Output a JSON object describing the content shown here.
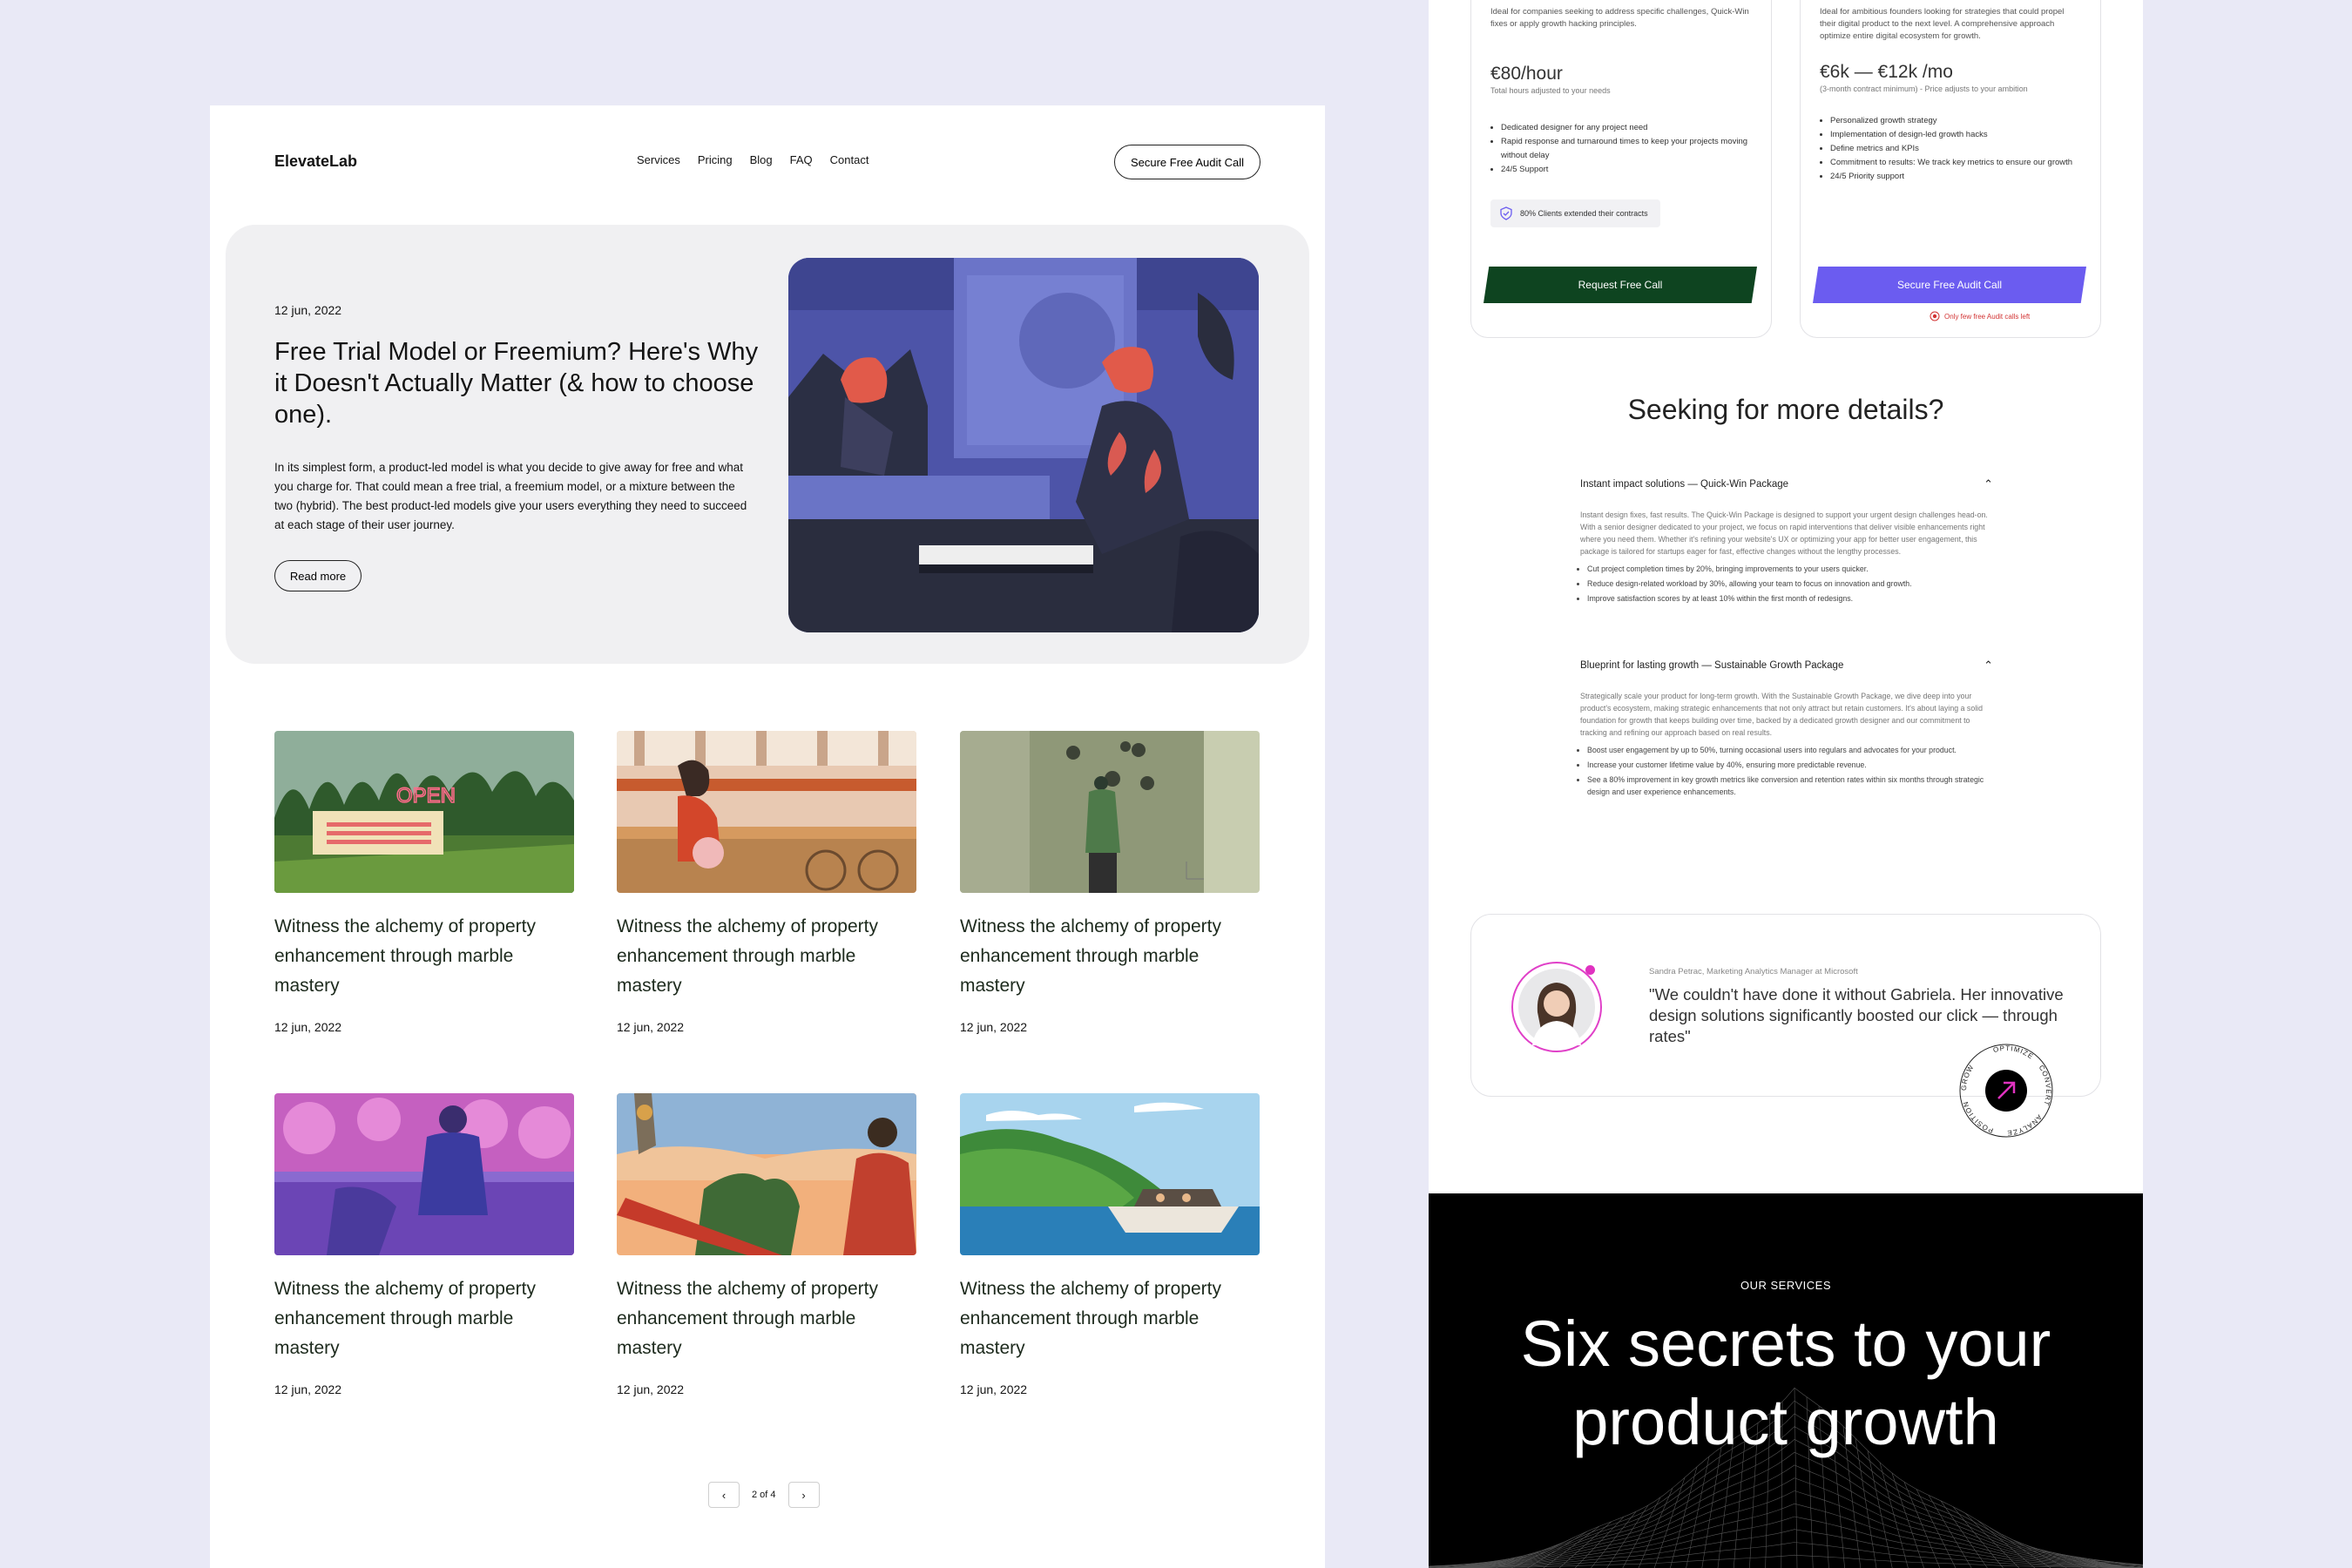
{
  "blog": {
    "logo": "ElevateLab",
    "nav": [
      "Services",
      "Pricing",
      "Blog",
      "FAQ",
      "Contact"
    ],
    "cta": "Secure Free Audit Call",
    "hero": {
      "date": "12 jun, 2022",
      "title": "Free Trial Model or Freemium? Here's Why it Doesn't Actually Matter (& how to choose one).",
      "body": "In its simplest form, a product-led model is what you decide to give away for free and what you charge for. That could mean a free trial, a freemium model, or a mixture between the two (hybrid). The best product-led models give your users everything they need to succeed at each stage of their user journey.",
      "read_more": "Read more"
    },
    "posts": [
      {
        "title": "Witness the alchemy of property enhancement through marble mastery",
        "date": "12 jun, 2022"
      },
      {
        "title": "Witness the alchemy of property enhancement through marble mastery",
        "date": "12 jun, 2022"
      },
      {
        "title": "Witness the alchemy of property enhancement through marble mastery",
        "date": "12 jun, 2022"
      },
      {
        "title": "Witness the alchemy of property enhancement through marble mastery",
        "date": "12 jun, 2022"
      },
      {
        "title": "Witness the alchemy of property enhancement through marble mastery",
        "date": "12 jun, 2022"
      },
      {
        "title": "Witness the alchemy of property enhancement through marble mastery",
        "date": "12 jun, 2022"
      }
    ],
    "pagination": {
      "prev": "‹",
      "label": "2 of 4",
      "next": "›"
    },
    "neon_sign": "OPEN"
  },
  "pricing": {
    "plans": [
      {
        "desc": "Ideal for companies seeking to address specific challenges, Quick-Win fixes or apply growth hacking principles.",
        "price": "€80/hour",
        "note": "Total hours adjusted to your needs",
        "features": [
          "Dedicated designer for any project need",
          "Rapid response and turnaround times to keep your projects moving without delay",
          "24/5 Support"
        ],
        "badge": "80% Clients extended their contracts",
        "button": "Request Free Call",
        "button_color": "#0e4420"
      },
      {
        "desc": "Ideal for ambitious founders looking for strategies that could propel their digital product to the next level. A comprehensive approach optimize entire digital ecosystem for growth.",
        "price": "€6k — €12k /mo",
        "note": "(3-month contract minimum) - Price adjusts to your ambition",
        "features": [
          "Personalized growth strategy",
          "Implementation of design-led growth hacks",
          "Define metrics and KPIs",
          "Commitment to results: We track key metrics to ensure our growth",
          "24/5 Priority support"
        ],
        "button": "Secure Free Audit Call",
        "button_color": "#6b5cf0",
        "scarcity": "Only few free Audit calls left"
      }
    ],
    "details_title": "Seeking for more details?",
    "faq": [
      {
        "title": "Instant impact solutions — Quick-Win Package",
        "body": "Instant design fixes, fast results. The Quick-Win Package is designed to support your urgent design challenges head-on. With a senior designer dedicated to your project, we focus on rapid interventions that deliver visible enhancements right where you need them. Whether it's refining your website's UX or optimizing your app for better user engagement, this package is tailored for startups eager for fast, effective changes without the lengthy processes.",
        "bullets": [
          "Cut project completion times by 20%, bringing improvements to your users quicker.",
          "Reduce design-related workload by 30%, allowing your team to focus on innovation and growth.",
          "Improve satisfaction scores by at least 10% within the first month of redesigns."
        ]
      },
      {
        "title": "Blueprint for lasting growth — Sustainable Growth Package",
        "body": "Strategically scale your product for long-term growth. With the Sustainable Growth Package, we dive deep into your product's ecosystem, making strategic enhancements that not only attract but retain customers. It's about laying a solid foundation for growth that keeps building over time, backed by a dedicated growth designer and our commitment to tracking and refining our approach based on real results.",
        "bullets": [
          "Boost user engagement by up to 50%, turning occasional users into regulars and advocates for your product.",
          "Increase your customer lifetime value by 40%, ensuring more predictable revenue.",
          "See a 80% improvement in key growth metrics like conversion and retention rates within six months through strategic design and user experience enhancements."
        ]
      }
    ],
    "testimonial": {
      "author": "Sandra Petrac, Marketing Analytics Manager at Microsoft",
      "quote": "\"We couldn't have done it without Gabriela. Her innovative design solutions significantly boosted our click — through rates\"",
      "badge_words": [
        "GROW",
        "OPTIMIZE",
        "CONVERT",
        "ANALYZE",
        "POSITION"
      ]
    }
  },
  "services": {
    "label": "OUR SERVICES",
    "title_line1": "Six secrets to your",
    "title_line2": "product growth"
  }
}
